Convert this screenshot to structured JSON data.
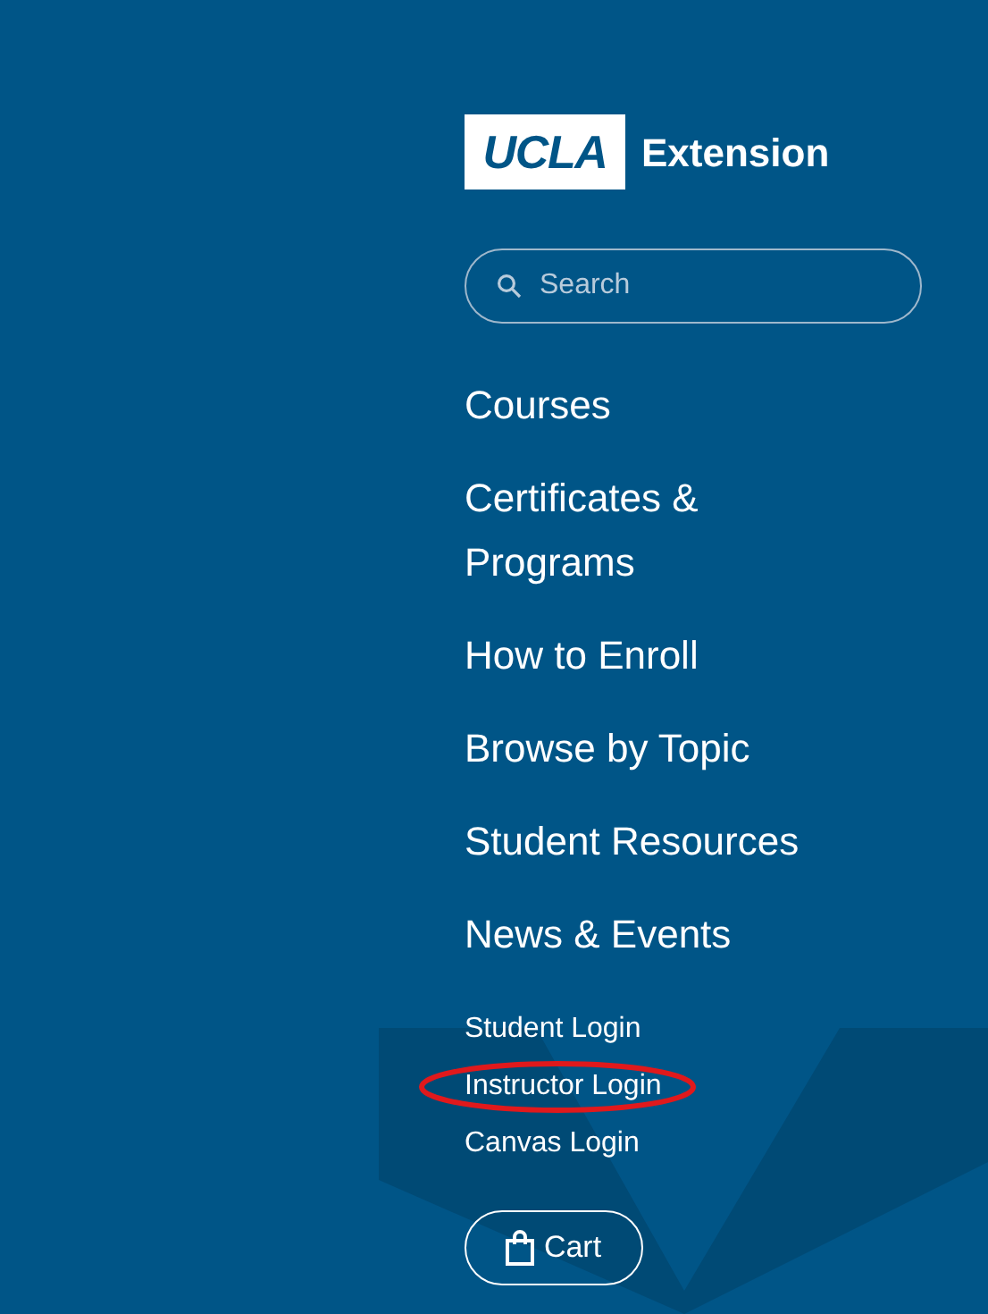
{
  "logo": {
    "mark": "UCLA",
    "text": "Extension"
  },
  "search": {
    "placeholder": "Search"
  },
  "nav": [
    "Courses",
    "Certificates & Programs",
    "How to Enroll",
    "Browse by Topic",
    "Student Resources",
    "News & Events"
  ],
  "logins": [
    {
      "label": "Student Login",
      "highlighted": false
    },
    {
      "label": "Instructor Login",
      "highlighted": true
    },
    {
      "label": "Canvas Login",
      "highlighted": false
    }
  ],
  "cart": {
    "label": "Cart"
  }
}
